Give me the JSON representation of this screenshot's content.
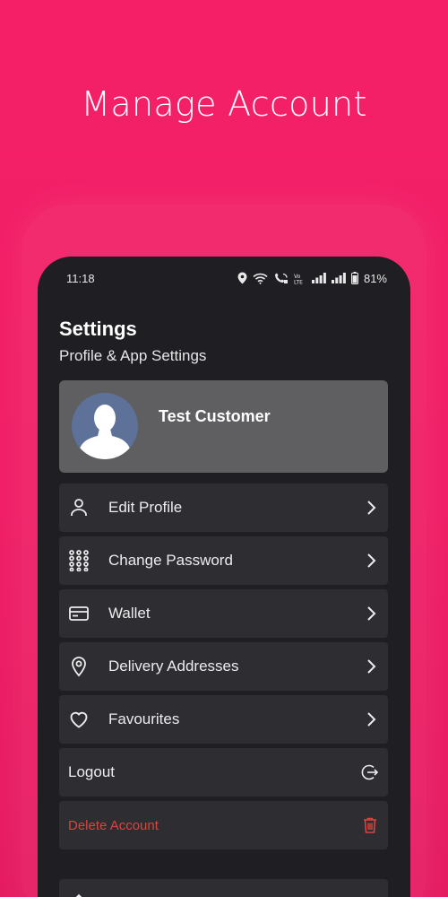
{
  "headline": "Manage Account",
  "status_bar": {
    "time": "11:18",
    "battery": "81%"
  },
  "settings": {
    "title": "Settings",
    "subtitle": "Profile & App Settings"
  },
  "profile": {
    "name": "Test Customer"
  },
  "menu": [
    {
      "label": "Edit Profile",
      "icon": "person-icon"
    },
    {
      "label": "Change Password",
      "icon": "keypad-icon"
    },
    {
      "label": "Wallet",
      "icon": "wallet-card-icon"
    },
    {
      "label": "Delivery Addresses",
      "icon": "location-pin-icon"
    },
    {
      "label": "Favourites",
      "icon": "heart-icon"
    }
  ],
  "logout": {
    "label": "Logout",
    "icon": "logout-icon"
  },
  "delete_account": {
    "label": "Delete Account",
    "icon": "trash-icon"
  },
  "colors": {
    "background": "#f41f67",
    "phone_surface": "#1f1e22",
    "card": "#2e2d31",
    "profile_card": "#5f5e60",
    "danger": "#d9443f"
  }
}
